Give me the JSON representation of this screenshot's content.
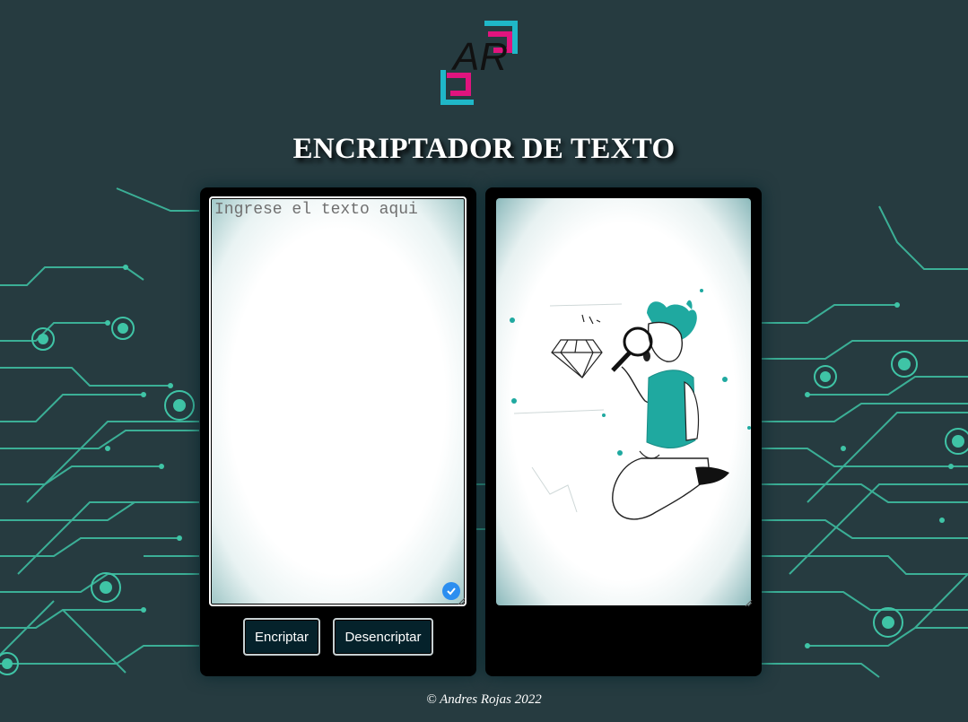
{
  "header": {
    "logo_letters": "AR",
    "title": "ENCRIPTADOR DE TEXTO"
  },
  "input": {
    "placeholder": "Ingrese el texto aqui",
    "value": ""
  },
  "buttons": {
    "encrypt_label": "Encriptar",
    "decrypt_label": "Desencriptar"
  },
  "output": {
    "illustration": "person-with-magnifying-glass-and-diamond"
  },
  "footer": {
    "credit": "© Andres Rojas 2022"
  },
  "colors": {
    "background": "#263b40",
    "circuit": "#3fc4a6",
    "accent_teal": "#1fa9a0",
    "accent_magenta": "#e0147e",
    "accent_cyan": "#1fb7c8",
    "panel": "#000000",
    "button": "#05222b"
  }
}
